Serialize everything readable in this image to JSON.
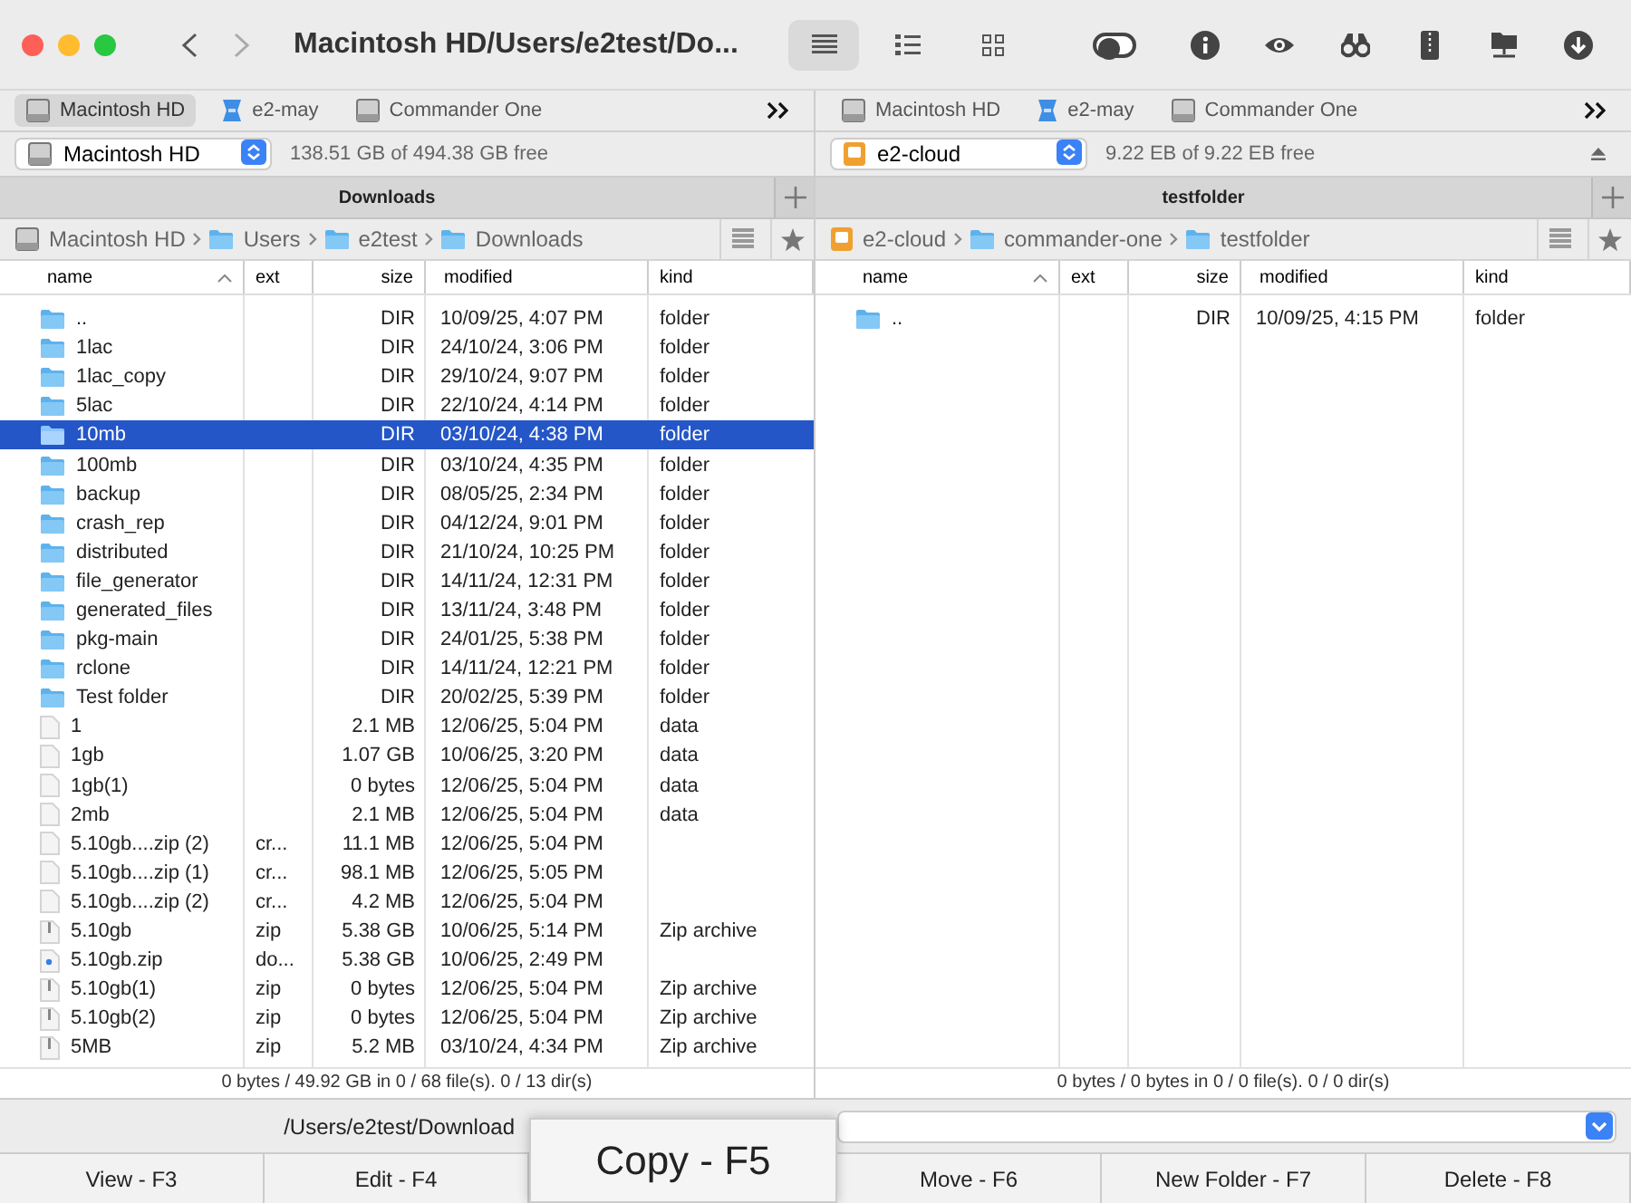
{
  "window": {
    "title": "Macintosh HD/Users/e2test/Do..."
  },
  "toolbar": {
    "view_modes": [
      {
        "kind": "list",
        "selected": true
      },
      {
        "kind": "detail",
        "selected": false
      },
      {
        "kind": "grid",
        "selected": false
      }
    ],
    "toggle": {
      "on": false
    }
  },
  "panels": [
    {
      "drive_tabs": [
        {
          "label": "Macintosh HD",
          "kind": "disk",
          "selected": true
        },
        {
          "label": "e2-may",
          "kind": "cloud",
          "selected": false
        },
        {
          "label": "Commander One",
          "kind": "disk",
          "selected": false
        }
      ],
      "drive": {
        "name": "Macintosh HD",
        "kind": "disk",
        "free": "138.51 GB of 494.38 GB free",
        "ejectable": false
      },
      "title": "Downloads",
      "breadcrumb": [
        {
          "label": "Macintosh HD",
          "kind": "disk"
        },
        {
          "label": "Users",
          "kind": "folder"
        },
        {
          "label": "e2test",
          "kind": "folder"
        },
        {
          "label": "Downloads",
          "kind": "folder"
        }
      ],
      "columns": [
        {
          "label": "name",
          "sorted": true
        },
        {
          "label": "ext",
          "sorted": false
        },
        {
          "label": "size",
          "sorted": false
        },
        {
          "label": "modified",
          "sorted": false
        },
        {
          "label": "kind",
          "sorted": false
        }
      ],
      "rows": [
        {
          "kind": "folder",
          "name": "..",
          "size": "DIR",
          "modified": "10/09/25, 4:07 PM",
          "kind_text": "folder",
          "selected": false
        },
        {
          "kind": "folder",
          "name": "1lac",
          "size": "DIR",
          "modified": "24/10/24, 3:06 PM",
          "kind_text": "folder",
          "selected": false
        },
        {
          "kind": "folder",
          "name": "1lac_copy",
          "size": "DIR",
          "modified": "29/10/24, 9:07 PM",
          "kind_text": "folder",
          "selected": false
        },
        {
          "kind": "folder",
          "name": "5lac",
          "size": "DIR",
          "modified": "22/10/24, 4:14 PM",
          "kind_text": "folder",
          "selected": false
        },
        {
          "kind": "folder",
          "name": "10mb",
          "size": "DIR",
          "modified": "03/10/24, 4:38 PM",
          "kind_text": "folder",
          "selected": true
        },
        {
          "kind": "folder",
          "name": "100mb",
          "size": "DIR",
          "modified": "03/10/24, 4:35 PM",
          "kind_text": "folder",
          "selected": false
        },
        {
          "kind": "folder",
          "name": "backup",
          "size": "DIR",
          "modified": "08/05/25, 2:34 PM",
          "kind_text": "folder",
          "selected": false
        },
        {
          "kind": "folder",
          "name": "crash_rep",
          "size": "DIR",
          "modified": "04/12/24, 9:01 PM",
          "kind_text": "folder",
          "selected": false
        },
        {
          "kind": "folder",
          "name": "distributed",
          "size": "DIR",
          "modified": "21/10/24, 10:25 PM",
          "kind_text": "folder",
          "selected": false
        },
        {
          "kind": "folder",
          "name": "file_generator",
          "size": "DIR",
          "modified": "14/11/24, 12:31 PM",
          "kind_text": "folder",
          "selected": false
        },
        {
          "kind": "folder",
          "name": "generated_files",
          "size": "DIR",
          "modified": "13/11/24, 3:48 PM",
          "kind_text": "folder",
          "selected": false
        },
        {
          "kind": "folder",
          "name": "pkg-main",
          "size": "DIR",
          "modified": "24/01/25, 5:38 PM",
          "kind_text": "folder",
          "selected": false
        },
        {
          "kind": "folder",
          "name": "rclone",
          "size": "DIR",
          "modified": "14/11/24, 12:21 PM",
          "kind_text": "folder",
          "selected": false
        },
        {
          "kind": "folder",
          "name": "Test folder",
          "size": "DIR",
          "modified": "20/02/25, 5:39 PM",
          "kind_text": "folder",
          "selected": false
        },
        {
          "kind": "file",
          "name": "1",
          "size": "2.1 MB",
          "modified": "12/06/25, 5:04 PM",
          "kind_text": "data",
          "selected": false
        },
        {
          "kind": "file",
          "name": "1gb",
          "size": "1.07 GB",
          "modified": "10/06/25, 3:20 PM",
          "kind_text": "data",
          "selected": false
        },
        {
          "kind": "file",
          "name": "1gb(1)",
          "size": "0 bytes",
          "modified": "12/06/25, 5:04 PM",
          "kind_text": "data",
          "selected": false
        },
        {
          "kind": "file",
          "name": "2mb",
          "size": "2.1 MB",
          "modified": "12/06/25, 5:04 PM",
          "kind_text": "data",
          "selected": false
        },
        {
          "kind": "file",
          "name": "5.10gb....zip (2)",
          "ext": "cr...",
          "size": "11.1 MB",
          "modified": "12/06/25, 5:04 PM",
          "selected": false
        },
        {
          "kind": "file",
          "name": "5.10gb....zip (1)",
          "ext": "cr...",
          "size": "98.1 MB",
          "modified": "12/06/25, 5:05 PM",
          "selected": false
        },
        {
          "kind": "file",
          "name": "5.10gb....zip (2)",
          "ext": "cr...",
          "size": "4.2 MB",
          "modified": "12/06/25, 5:04 PM",
          "selected": false
        },
        {
          "kind": "archive",
          "name": "5.10gb",
          "ext": "zip",
          "size": "5.38 GB",
          "modified": "10/06/25, 5:14 PM",
          "kind_text": "Zip archive",
          "selected": false
        },
        {
          "kind": "document",
          "name": "5.10gb.zip",
          "ext": "do...",
          "size": "5.38 GB",
          "modified": "10/06/25, 2:49 PM",
          "selected": false
        },
        {
          "kind": "archive",
          "name": "5.10gb(1)",
          "ext": "zip",
          "size": "0 bytes",
          "modified": "12/06/25, 5:04 PM",
          "kind_text": "Zip archive",
          "selected": false
        },
        {
          "kind": "archive",
          "name": "5.10gb(2)",
          "ext": "zip",
          "size": "0 bytes",
          "modified": "12/06/25, 5:04 PM",
          "kind_text": "Zip archive",
          "selected": false
        },
        {
          "kind": "archive",
          "name": "5MB",
          "ext": "zip",
          "size": "5.2 MB",
          "modified": "03/10/24, 4:34 PM",
          "kind_text": "Zip archive",
          "selected": false
        }
      ],
      "status": "0 bytes / 49.92 GB in 0 / 68 file(s). 0 / 13 dir(s)"
    },
    {
      "drive_tabs": [
        {
          "label": "Macintosh HD",
          "kind": "disk",
          "selected": false
        },
        {
          "label": "e2-may",
          "kind": "cloud",
          "selected": false
        },
        {
          "label": "Commander One",
          "kind": "disk",
          "selected": false
        }
      ],
      "drive": {
        "name": "e2-cloud",
        "kind": "cloud-drive",
        "free": "9.22 EB of 9.22 EB free",
        "ejectable": true
      },
      "title": "testfolder",
      "breadcrumb": [
        {
          "label": "e2-cloud",
          "kind": "cloud-drive"
        },
        {
          "label": "commander-one",
          "kind": "folder"
        },
        {
          "label": "testfolder",
          "kind": "folder"
        }
      ],
      "columns": [
        {
          "label": "name",
          "sorted": true
        },
        {
          "label": "ext",
          "sorted": false
        },
        {
          "label": "size",
          "sorted": false
        },
        {
          "label": "modified",
          "sorted": false
        },
        {
          "label": "kind",
          "sorted": false
        }
      ],
      "rows": [
        {
          "kind": "folder",
          "name": "..",
          "size": "DIR",
          "modified": "10/09/25, 4:15 PM",
          "kind_text": "folder",
          "selected": false
        }
      ],
      "status": "0 bytes / 0 bytes in 0 / 0 file(s). 0 / 0 dir(s)"
    }
  ],
  "command_line": {
    "path": "/Users/e2test/Download"
  },
  "function_keys": [
    {
      "label": "View - F3",
      "raised": false
    },
    {
      "label": "Edit - F4",
      "raised": false
    },
    {
      "label": "Copy - F5",
      "raised": true
    },
    {
      "label": "Move - F6",
      "raised": false
    },
    {
      "label": "New Folder - F7",
      "raised": false
    },
    {
      "label": "Delete - F8",
      "raised": false
    }
  ]
}
